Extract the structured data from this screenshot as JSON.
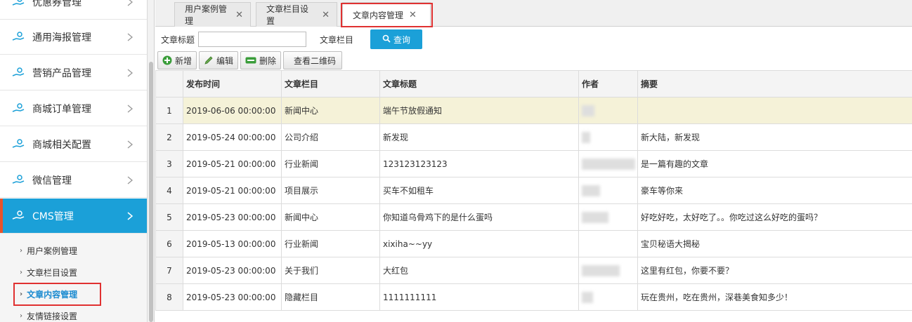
{
  "sidebar": {
    "items": [
      {
        "label": "优惠券管理"
      },
      {
        "label": "通用海报管理"
      },
      {
        "label": "营销产品管理"
      },
      {
        "label": "商城订单管理"
      },
      {
        "label": "商城相关配置"
      },
      {
        "label": "微信管理"
      },
      {
        "label": "CMS管理"
      }
    ],
    "submenu": [
      {
        "label": "用户案例管理"
      },
      {
        "label": "文章栏目设置"
      },
      {
        "label": "文章内容管理"
      },
      {
        "label": "友情链接设置"
      }
    ]
  },
  "tabs": [
    {
      "label": "用户案例管理"
    },
    {
      "label": "文章栏目设置"
    },
    {
      "label": "文章内容管理"
    }
  ],
  "search": {
    "title_label": "文章标题",
    "title_value": "",
    "column_label": "文章栏目",
    "query_button": "查询"
  },
  "toolbar": {
    "add": "新增",
    "edit": "编辑",
    "delete": "删除",
    "qrcode": "查看二维码"
  },
  "table": {
    "headers": [
      "发布时间",
      "文章栏目",
      "文章标题",
      "作者",
      "摘要"
    ],
    "rows": [
      {
        "num": "1",
        "time": "2019-06-06 00:00:00",
        "column": "新闻中心",
        "title": "端午节放假通知",
        "summary": ""
      },
      {
        "num": "2",
        "time": "2019-05-24 00:00:00",
        "column": "公司介绍",
        "title": "新发现",
        "summary": "新大陆，新发现"
      },
      {
        "num": "3",
        "time": "2019-05-21 00:00:00",
        "column": "行业新闻",
        "title": "123123123123",
        "summary": "是一篇有趣的文章"
      },
      {
        "num": "4",
        "time": "2019-05-21 00:00:00",
        "column": "项目展示",
        "title": "买车不如租车",
        "summary": "豪车等你来"
      },
      {
        "num": "5",
        "time": "2019-05-23 00:00:00",
        "column": "新闻中心",
        "title": "你知道乌骨鸡下的是什么蛋吗",
        "summary": "好吃好吃，太好吃了。。你吃过这么好吃的蛋吗？"
      },
      {
        "num": "6",
        "time": "2019-05-13 00:00:00",
        "column": "行业新闻",
        "title": "xixiha~~yy",
        "summary": "宝贝秘语大揭秘"
      },
      {
        "num": "7",
        "time": "2019-05-23 00:00:00",
        "column": "关于我们",
        "title": "大红包",
        "summary": "这里有红包，你要不要？"
      },
      {
        "num": "8",
        "time": "2019-05-23 00:00:00",
        "column": "隐藏栏目",
        "title": "1111111111",
        "summary": "玩在贵州，吃在贵州，深巷美食知多少！"
      }
    ]
  },
  "colors": {
    "accent": "#1ba0d8",
    "highlight": "#e03131",
    "selected_row": "#f5f2d8"
  }
}
